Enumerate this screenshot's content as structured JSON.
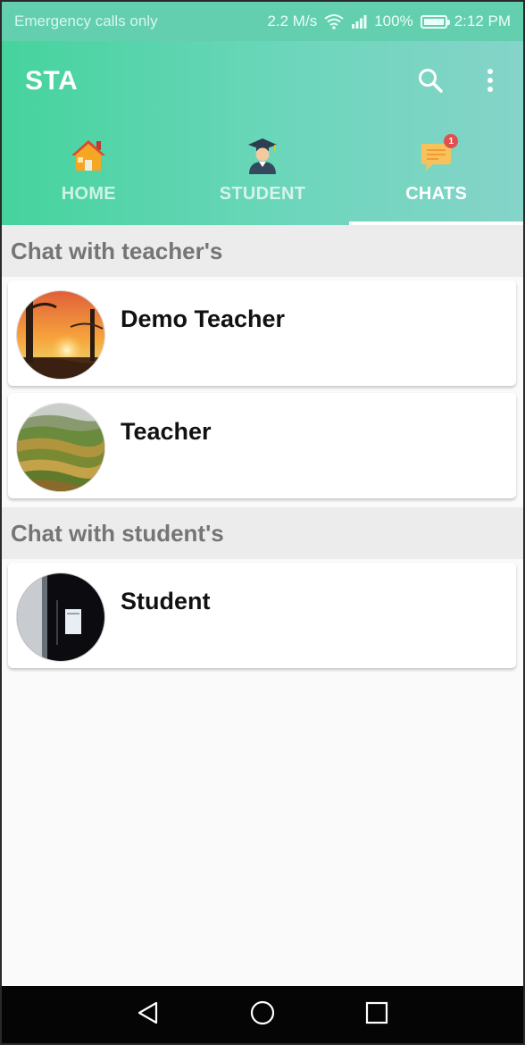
{
  "status_bar": {
    "carrier": "Emergency calls only",
    "speed": "2.2 M/s",
    "battery": "100%",
    "time": "2:12 PM",
    "icons": [
      "wifi-icon",
      "signal-icon",
      "battery-icon"
    ]
  },
  "app_bar": {
    "title": "STA",
    "actions": [
      "search-icon",
      "more-vert-icon"
    ]
  },
  "tabs": [
    {
      "label": "HOME",
      "icon": "home-icon"
    },
    {
      "label": "STUDENT",
      "icon": "graduate-icon"
    },
    {
      "label": "CHATS",
      "icon": "chat-icon",
      "badge": "1",
      "active": true
    }
  ],
  "sections": [
    {
      "header": "Chat with teacher's",
      "items": [
        {
          "name": "Demo Teacher",
          "avatar": "sunset-photo"
        },
        {
          "name": "Teacher",
          "avatar": "landscape-photo"
        }
      ]
    },
    {
      "header": "Chat with student's",
      "items": [
        {
          "name": "Student",
          "avatar": "dark-photo"
        }
      ]
    }
  ],
  "nav_bar": {
    "buttons": [
      "back-icon",
      "home-circle-icon",
      "recents-icon"
    ]
  },
  "colors": {
    "accent_start": "#45d39d",
    "accent_end": "#85d4c9",
    "status_bar": "#63cfae",
    "section_header_bg": "#ececec",
    "section_header_text": "#757575",
    "badge": "#e0504f"
  }
}
